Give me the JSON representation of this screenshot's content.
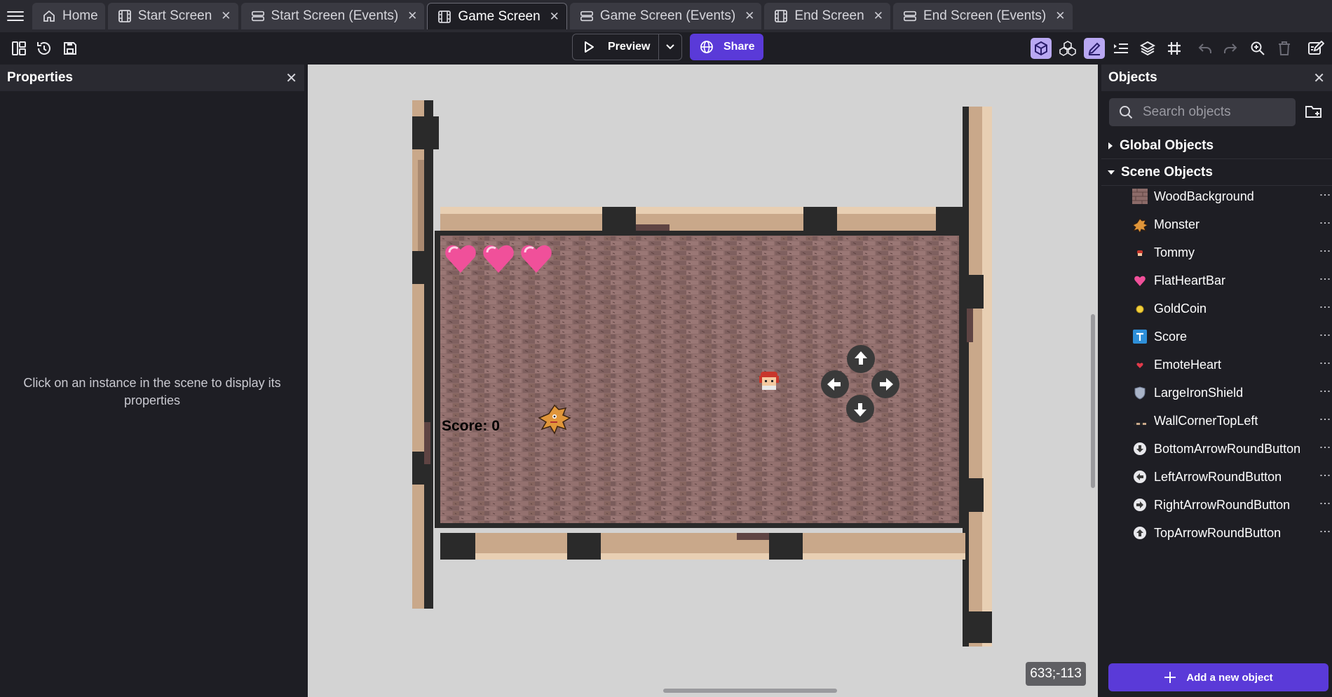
{
  "tabs": [
    {
      "label": "Home",
      "icon": "home-icon",
      "closable": false,
      "active": false
    },
    {
      "label": "Start Screen",
      "icon": "film-icon",
      "closable": true,
      "active": false
    },
    {
      "label": "Start Screen (Events)",
      "icon": "events-icon",
      "closable": true,
      "active": false
    },
    {
      "label": "Game Screen",
      "icon": "film-icon",
      "closable": true,
      "active": true
    },
    {
      "label": "Game Screen (Events)",
      "icon": "events-icon",
      "closable": true,
      "active": false
    },
    {
      "label": "End Screen",
      "icon": "film-icon",
      "closable": true,
      "active": false
    },
    {
      "label": "End Screen (Events)",
      "icon": "events-icon",
      "closable": true,
      "active": false
    }
  ],
  "toolbar": {
    "preview_label": "Preview",
    "share_label": "Share"
  },
  "properties": {
    "title": "Properties",
    "empty_message": "Click on an instance in the scene to display its properties"
  },
  "scene": {
    "score_text": "Score: 0",
    "hearts": 3,
    "coordinates": "633;-113"
  },
  "objects_panel": {
    "title": "Objects",
    "search_placeholder": "Search objects",
    "global_section": "Global Objects",
    "scene_section": "Scene Objects",
    "items": [
      {
        "name": "WoodBackground",
        "icon": "wood-texture-icon"
      },
      {
        "name": "Monster",
        "icon": "monster-sprite-icon"
      },
      {
        "name": "Tommy",
        "icon": "tommy-sprite-icon"
      },
      {
        "name": "FlatHeartBar",
        "icon": "heart-icon"
      },
      {
        "name": "GoldCoin",
        "icon": "coin-icon"
      },
      {
        "name": "Score",
        "icon": "text-object-icon"
      },
      {
        "name": "EmoteHeart",
        "icon": "small-heart-icon"
      },
      {
        "name": "LargeIronShield",
        "icon": "shield-icon"
      },
      {
        "name": "WallCornerTopLeft",
        "icon": "wall-corner-icon"
      },
      {
        "name": "BottomArrowRoundButton",
        "icon": "arrow-down-button-icon"
      },
      {
        "name": "LeftArrowRoundButton",
        "icon": "arrow-left-button-icon"
      },
      {
        "name": "RightArrowRoundButton",
        "icon": "arrow-right-button-icon"
      },
      {
        "name": "TopArrowRoundButton",
        "icon": "arrow-up-button-icon"
      }
    ],
    "add_label": "Add a new object"
  },
  "colors": {
    "accent": "#5a3ad8",
    "panel_bg": "#1e1e24",
    "header_bg": "#2a2a31",
    "canvas_bg": "#d3d3d3",
    "heart": "#f0509a",
    "floor": "#8a6a68"
  }
}
